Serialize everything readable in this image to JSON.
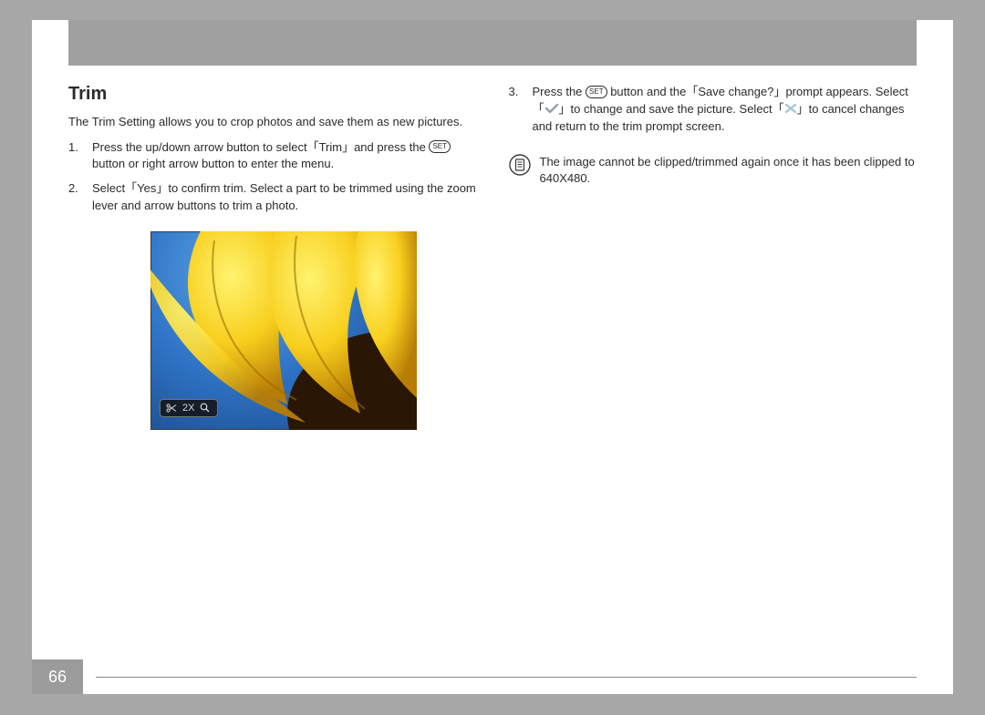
{
  "page_number": "66",
  "title": "Trim",
  "intro": "The Trim Setting allows you to crop photos and save them as new pictures.",
  "set_label": "SET",
  "steps_left": [
    {
      "num": "1.",
      "pre": "Press the up/down arrow button to select「Trim」and press the ",
      "post": " button or right arrow button to enter the menu."
    },
    {
      "num": "2.",
      "pre": "Select「Yes」to confirm trim. Select a part to be trimmed using the zoom lever and arrow buttons to trim a photo.",
      "post": ""
    }
  ],
  "step_right": {
    "num": "3.",
    "a": "Press the ",
    "b": " button and the「Save change?」prompt appears. Select「",
    "c": "」to change and save the picture. Select「",
    "d": "」to cancel changes and return to the trim prompt screen."
  },
  "note": "The image cannot be clipped/trimmed again once it has been clipped to 640X480.",
  "zoom_label": "2X"
}
